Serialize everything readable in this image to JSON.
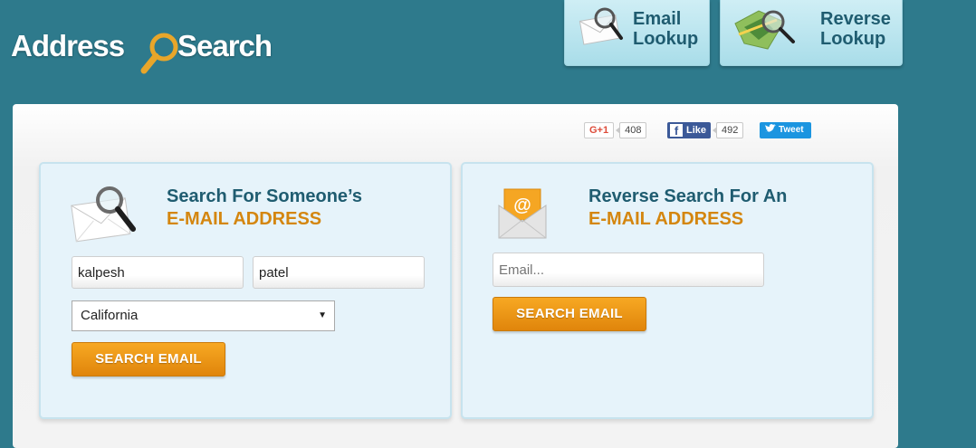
{
  "header": {
    "logo_text_1": "Address",
    "logo_text_2": "Search",
    "nav": [
      {
        "label": "Email\nLookup",
        "icon": "envelope-magnifier-icon"
      },
      {
        "label": "Reverse\nLookup",
        "icon": "map-magnifier-icon"
      }
    ]
  },
  "social": {
    "gplus_label": "G+1",
    "gplus_count": "408",
    "fb_label": "Like",
    "fb_count": "492",
    "tweet_label": "Tweet"
  },
  "left_card": {
    "icon": "envelope-magnifier-icon",
    "heading_line1": "Search For Someone’s",
    "heading_line2": "E-MAIL ADDRESS",
    "first_name_value": "kalpesh",
    "last_name_value": "patel",
    "state_selected": "California",
    "button_label": "SEARCH EMAIL"
  },
  "right_card": {
    "icon": "envelope-at-icon",
    "heading_line1": "Reverse Search For An",
    "heading_line2": "E-MAIL ADDRESS",
    "email_placeholder": "Email...",
    "button_label": "SEARCH EMAIL"
  },
  "colors": {
    "background": "#2e7a8c",
    "heading_blue": "#1f5c70",
    "heading_orange": "#d4860f",
    "button_orange": "#f29a1a"
  }
}
